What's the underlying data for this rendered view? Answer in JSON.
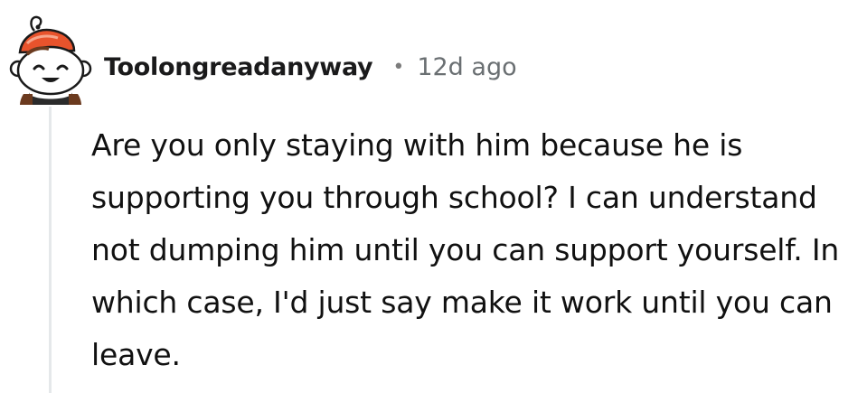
{
  "comment": {
    "author": "Toolongreadanyway",
    "separator": "•",
    "timestamp": "12d ago",
    "body": "Are you only staying with him because he is supporting you through school? I can understand not dumping him until you can support yourself. In which case, I'd just say make it work until you can leave."
  },
  "avatar": {
    "icon": "snoo-avatar-icon",
    "hat_color": "#e8532c",
    "hair_color": "#6b3a1e",
    "shirt_color": "#2b2b2b"
  },
  "colors": {
    "thread_line": "#e5e8ea",
    "meta_text": "#6a6f72"
  }
}
